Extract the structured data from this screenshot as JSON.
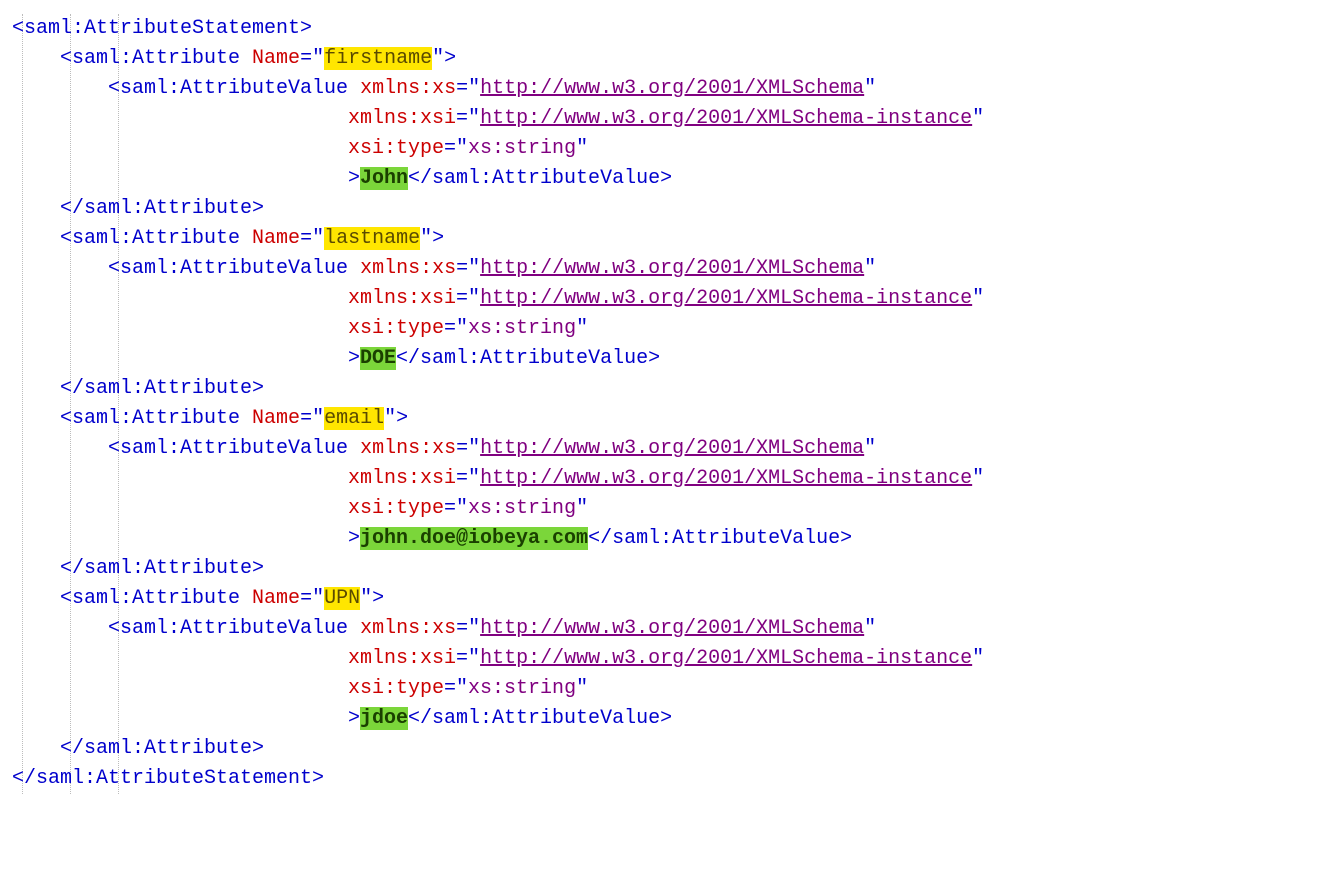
{
  "root": {
    "open": "<saml:AttributeStatement>",
    "close": "</saml:AttributeStatement>"
  },
  "common": {
    "attr_open_prefix": "<saml:Attribute",
    "attr_name_label": "Name",
    "attr_open_suffix": ">",
    "attr_close": "</saml:Attribute>",
    "val_open_prefix": "<saml:AttributeValue",
    "val_close": "</saml:AttributeValue>",
    "xmlns_xs_label": "xmlns:xs",
    "xmlns_xsi_label": "xmlns:xsi",
    "xsi_type_label": "xsi:type",
    "xs_url": "http://www.w3.org/2001/XMLSchema",
    "xsi_url": "http://www.w3.org/2001/XMLSchema-instance",
    "xsi_type_val": "xs:string",
    "gt": ">",
    "quote": "\""
  },
  "attributes": [
    {
      "name": "firstname",
      "value": "John"
    },
    {
      "name": "lastname",
      "value": "DOE"
    },
    {
      "name": "email",
      "value": "john.doe@iobeya.com"
    },
    {
      "name": "UPN",
      "value": "jdoe"
    }
  ]
}
